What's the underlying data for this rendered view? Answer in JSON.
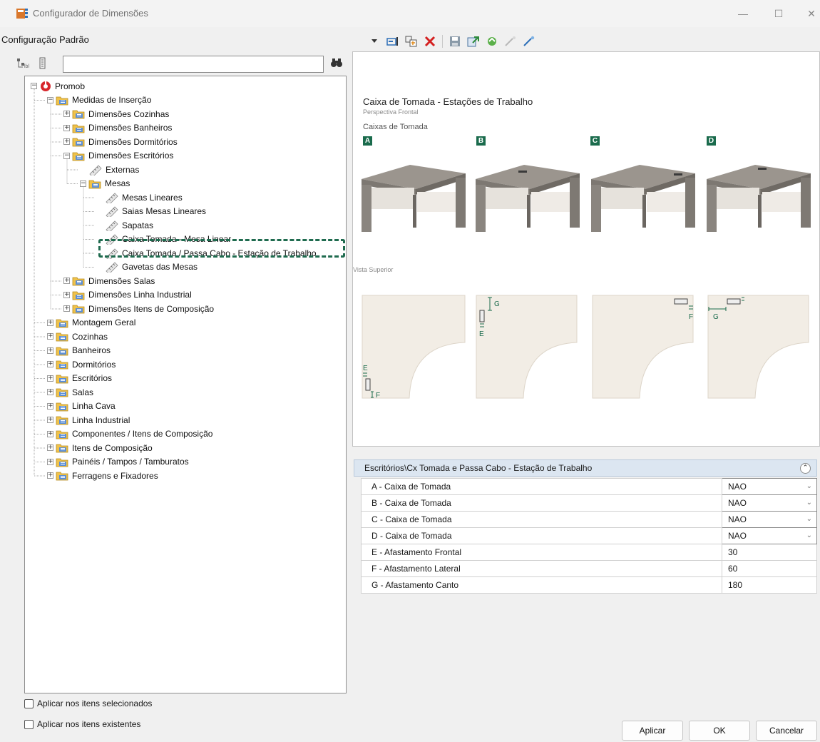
{
  "window": {
    "title": "Configurador de Dimensões",
    "minimize_glyph": "—",
    "maximize_glyph": "☐",
    "close_glyph": "✕"
  },
  "config_label": "Configuração Padrão",
  "search": {
    "value": "",
    "placeholder": ""
  },
  "tree": [
    {
      "label": "Promob",
      "depth": 0,
      "expander": "−",
      "icon": "promob-logo-icon"
    },
    {
      "label": "Medidas de Inserção",
      "depth": 1,
      "expander": "−",
      "icon": "folder-icon"
    },
    {
      "label": "Dimensões Cozinhas",
      "depth": 2,
      "expander": "+",
      "icon": "folder-icon"
    },
    {
      "label": "Dimensões Banheiros",
      "depth": 2,
      "expander": "+",
      "icon": "folder-icon"
    },
    {
      "label": "Dimensões Dormitórios",
      "depth": 2,
      "expander": "+",
      "icon": "folder-icon"
    },
    {
      "label": "Dimensões Escritórios",
      "depth": 2,
      "expander": "−",
      "icon": "folder-icon"
    },
    {
      "label": "Externas",
      "depth": 3,
      "expander": "",
      "icon": "ruler-icon"
    },
    {
      "label": "Mesas",
      "depth": 3,
      "expander": "−",
      "icon": "folder-icon"
    },
    {
      "label": "Mesas Lineares",
      "depth": 4,
      "expander": "",
      "icon": "ruler-icon"
    },
    {
      "label": "Saias Mesas Lineares",
      "depth": 4,
      "expander": "",
      "icon": "ruler-icon"
    },
    {
      "label": "Sapatas",
      "depth": 4,
      "expander": "",
      "icon": "ruler-icon"
    },
    {
      "label": "Caixa Tomada - Mesa Linear",
      "depth": 4,
      "expander": "",
      "icon": "ruler-icon"
    },
    {
      "label": "Caixa Tomada / Passa Cabo - Estação de Trabalho",
      "depth": 4,
      "expander": "",
      "icon": "ruler-icon",
      "selected": true
    },
    {
      "label": "Gavetas das Mesas",
      "depth": 4,
      "expander": "",
      "icon": "ruler-icon"
    },
    {
      "label": "Dimensões Salas",
      "depth": 2,
      "expander": "+",
      "icon": "folder-icon"
    },
    {
      "label": "Dimensões Linha Industrial",
      "depth": 2,
      "expander": "+",
      "icon": "folder-icon"
    },
    {
      "label": "Dimensões Itens de Composição",
      "depth": 2,
      "expander": "+",
      "icon": "folder-icon"
    },
    {
      "label": "Montagem Geral",
      "depth": 1,
      "expander": "+",
      "icon": "folder-icon"
    },
    {
      "label": "Cozinhas",
      "depth": 1,
      "expander": "+",
      "icon": "folder-icon"
    },
    {
      "label": "Banheiros",
      "depth": 1,
      "expander": "+",
      "icon": "folder-icon"
    },
    {
      "label": "Dormitórios",
      "depth": 1,
      "expander": "+",
      "icon": "folder-icon"
    },
    {
      "label": "Escritórios",
      "depth": 1,
      "expander": "+",
      "icon": "folder-icon"
    },
    {
      "label": "Salas",
      "depth": 1,
      "expander": "+",
      "icon": "folder-icon"
    },
    {
      "label": "Linha Cava",
      "depth": 1,
      "expander": "+",
      "icon": "folder-icon"
    },
    {
      "label": "Linha Industrial",
      "depth": 1,
      "expander": "+",
      "icon": "folder-icon"
    },
    {
      "label": "Componentes / Itens de Composição",
      "depth": 1,
      "expander": "+",
      "icon": "folder-icon"
    },
    {
      "label": "Itens de Composição",
      "depth": 1,
      "expander": "+",
      "icon": "folder-icon"
    },
    {
      "label": "Painéis / Tampos / Tamburatos",
      "depth": 1,
      "expander": "+",
      "icon": "folder-icon"
    },
    {
      "label": "Ferragens e Fixadores",
      "depth": 1,
      "expander": "+",
      "icon": "folder-icon"
    }
  ],
  "preview": {
    "title": "Caixa de Tomada - Estações de Trabalho",
    "subtitle": "Perspectiva Frontal",
    "caixas_label": "Caixas de Tomada",
    "letters": [
      "A",
      "B",
      "C",
      "D"
    ],
    "vista_label": "Vista Superior",
    "dim_labels": {
      "e": "E",
      "f": "F",
      "g": "G"
    }
  },
  "properties": {
    "header": "Escritórios\\Cx Tomada e Passa Cabo - Estação de Trabalho",
    "collapse_glyph": "⌃",
    "rows": [
      {
        "name": "A - Caixa de Tomada",
        "value": "NAO",
        "dropdown": true
      },
      {
        "name": "B - Caixa de Tomada",
        "value": "NAO",
        "dropdown": true
      },
      {
        "name": "C - Caixa de Tomada",
        "value": "NAO",
        "dropdown": true
      },
      {
        "name": "D - Caixa de Tomada",
        "value": "NAO",
        "dropdown": true
      },
      {
        "name": "E - Afastamento Frontal",
        "value": "30",
        "dropdown": false
      },
      {
        "name": "F - Afastamento Lateral",
        "value": "60",
        "dropdown": false
      },
      {
        "name": "G - Afastamento Canto",
        "value": "180",
        "dropdown": false
      }
    ]
  },
  "checkboxes": {
    "selected_items": "Aplicar nos itens selecionados",
    "existing_items": "Aplicar nos itens existentes"
  },
  "buttons": {
    "apply": "Aplicar",
    "ok": "OK",
    "cancel": "Cancelar"
  },
  "colors": {
    "accent_green": "#1a6b4c",
    "grid_header": "#dce6f1",
    "folder": "#f0c24a",
    "desk": "#8f8a84"
  }
}
